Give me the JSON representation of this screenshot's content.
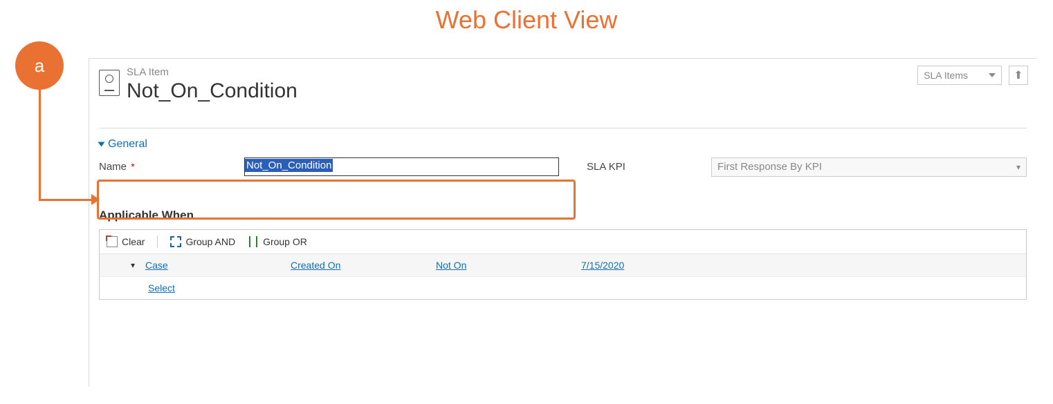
{
  "page_title": "Web Client View",
  "badge_label": "a",
  "header": {
    "entity_label": "SLA Item",
    "record_title": "Not_On_Condition",
    "dropdown_label": "SLA Items"
  },
  "section": {
    "label": "General"
  },
  "form": {
    "name_label": "Name",
    "required_mark": "*",
    "name_value": "Not_On_Condition",
    "kpi_label": "SLA KPI",
    "kpi_value": "First Response By KPI"
  },
  "applicable_when": {
    "header": "Applicable When",
    "toolbar": {
      "clear": "Clear",
      "group_and": "Group AND",
      "group_or": "Group OR"
    },
    "row": {
      "entity": "Case",
      "field": "Created On",
      "operator": "Not On",
      "value": "7/15/2020"
    },
    "select_label": "Select"
  }
}
